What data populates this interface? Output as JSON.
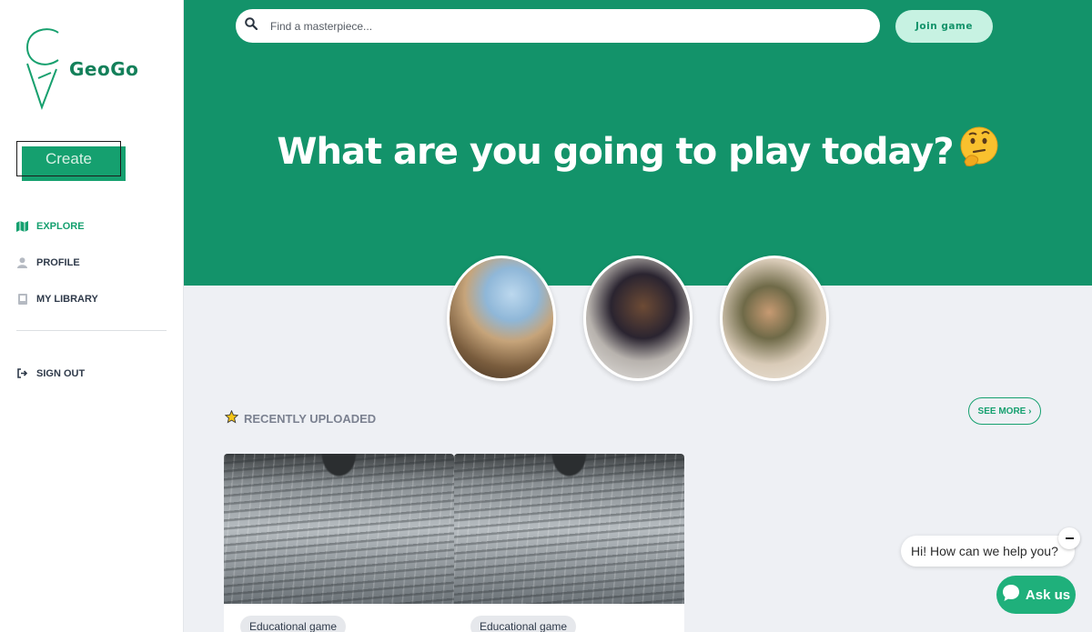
{
  "brand": {
    "name": "GeoGo",
    "accent": "#13936a"
  },
  "sidebar": {
    "create_label": "Create",
    "items": [
      {
        "label": "EXPLORE",
        "icon": "map-icon",
        "active": true
      },
      {
        "label": "PROFILE",
        "icon": "user-icon",
        "active": false
      },
      {
        "label": "MY LIBRARY",
        "icon": "book-icon",
        "active": false
      }
    ],
    "signout_label": "SIGN OUT",
    "signout_icon": "sign-out-icon"
  },
  "header": {
    "search_placeholder": "Find a masterpiece...",
    "join_label": "Join game"
  },
  "hero": {
    "title": "What are you going to play today?",
    "emoji": "thinking-face-emoji"
  },
  "recent": {
    "title": "RECENTLY UPLOADED",
    "see_more": "SEE MORE ›",
    "cards": [
      {
        "tag": "Educational game"
      },
      {
        "tag": "Educational game"
      }
    ]
  },
  "chat": {
    "bubble_text": "Hi! How can we help you?",
    "ask_label": "Ask us"
  }
}
